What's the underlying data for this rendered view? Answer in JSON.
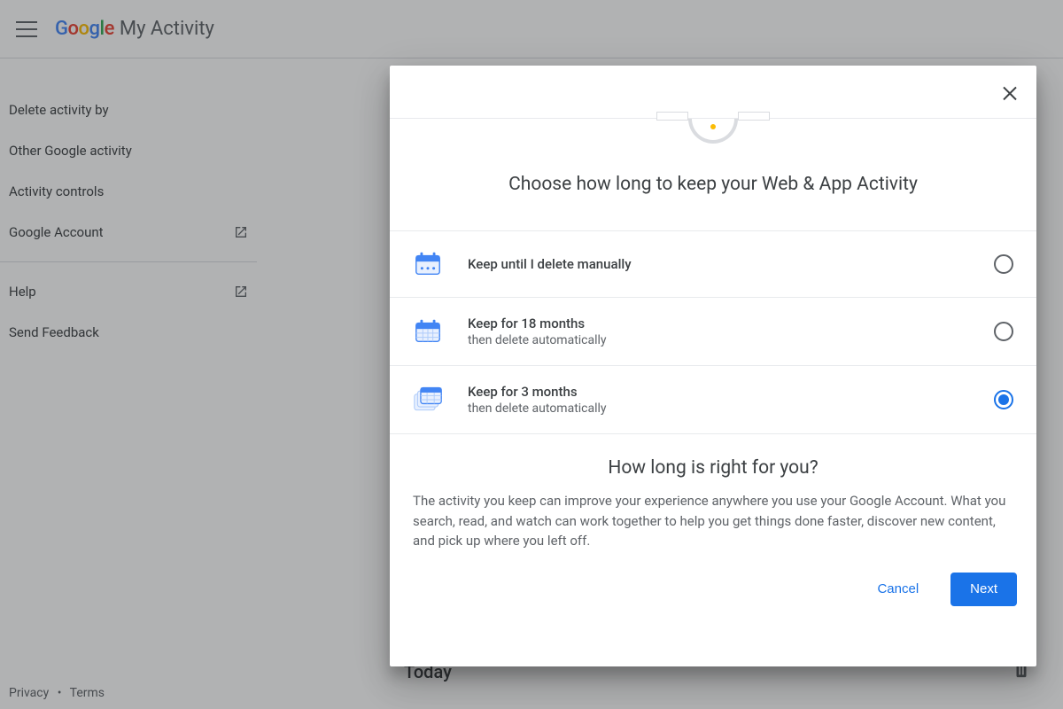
{
  "header": {
    "brand_prefix": "Google",
    "brand_suffix": "My Activity"
  },
  "sidebar": {
    "items": [
      {
        "label": "Delete activity by",
        "external": false
      },
      {
        "label": "Other Google activity",
        "external": false
      },
      {
        "label": "Activity controls",
        "external": false
      },
      {
        "label": "Google Account",
        "external": true
      }
    ],
    "secondary": [
      {
        "label": "Help",
        "external": true
      },
      {
        "label": "Send Feedback",
        "external": false
      }
    ],
    "footer": {
      "privacy": "Privacy",
      "terms": "Terms"
    }
  },
  "main": {
    "today_label": "Today"
  },
  "dialog": {
    "title": "Choose how long to keep your Web & App Activity",
    "options": [
      {
        "title": "Keep until I delete manually",
        "sub": "",
        "selected": false
      },
      {
        "title": "Keep for 18 months",
        "sub": "then delete automatically",
        "selected": false
      },
      {
        "title": "Keep for 3 months",
        "sub": "then delete automatically",
        "selected": true
      }
    ],
    "info_title": "How long is right for you?",
    "info_body": "The activity you keep can improve your experience anywhere you use your Google Account. What you search, read, and watch can work together to help you get things done faster, discover new content, and pick up where you left off.",
    "actions": {
      "cancel": "Cancel",
      "next": "Next"
    }
  }
}
